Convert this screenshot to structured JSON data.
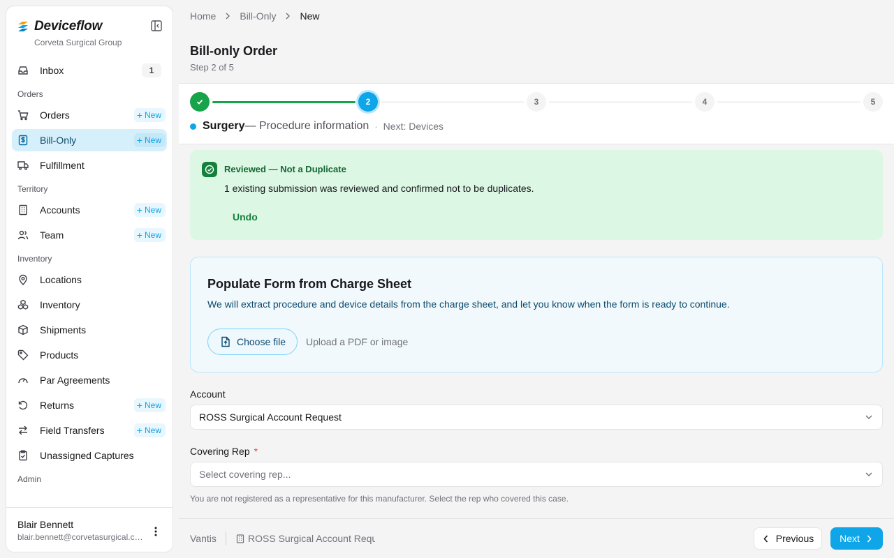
{
  "brand": {
    "name": "Deviceflow",
    "org": "Corveta Surgical Group"
  },
  "sidebar": {
    "inbox": {
      "label": "Inbox",
      "count": "1"
    },
    "sections": {
      "orders": "Orders",
      "territory": "Territory",
      "inventory": "Inventory",
      "admin": "Admin"
    },
    "new_label": "New",
    "items": {
      "orders": "Orders",
      "bill_only": "Bill-Only",
      "fulfillment": "Fulfillment",
      "accounts": "Accounts",
      "team": "Team",
      "locations": "Locations",
      "inventory": "Inventory",
      "shipments": "Shipments",
      "products": "Products",
      "par_agreements": "Par Agreements",
      "returns": "Returns",
      "field_transfers": "Field Transfers",
      "unassigned_captures": "Unassigned Captures"
    },
    "active_item": "bill_only"
  },
  "user": {
    "name": "Blair Bennett",
    "email": "blair.bennett@corvetasurgical.com"
  },
  "breadcrumb": {
    "home": "Home",
    "section": "Bill-Only",
    "current": "New"
  },
  "page": {
    "title": "Bill-only Order",
    "step": "Step 2 of 5"
  },
  "stepper": {
    "steps": [
      "1",
      "2",
      "3",
      "4",
      "5"
    ],
    "current_step": 2,
    "caption_title": "Surgery",
    "caption_sub": "— Procedure information",
    "caption_sep": "·",
    "caption_next": "Next: Devices"
  },
  "banner": {
    "title": "Reviewed — Not a Duplicate",
    "text": "1 existing submission was reviewed and confirmed not to be duplicates.",
    "undo": "Undo"
  },
  "upload": {
    "title": "Populate Form from Charge Sheet",
    "description": "We will extract procedure and device details from the charge sheet, and let you know when the form is ready to continue.",
    "button": "Choose file",
    "hint": "Upload a PDF or image"
  },
  "form": {
    "account_label": "Account",
    "account_value": "ROSS Surgical Account Request",
    "rep_label": "Covering Rep",
    "rep_required": "*",
    "rep_placeholder": "Select covering rep...",
    "rep_help": "You are not registered as a representative for this manufacturer. Select the rep who covered this case."
  },
  "footer": {
    "manufacturer": "Vantis",
    "account": "ROSS Surgical Account Request",
    "previous": "Previous",
    "next": "Next"
  },
  "colors": {
    "accent": "#0ea5e9",
    "success": "#16a34a",
    "active_nav_bg": "#d6f0fb",
    "banner_bg": "#dcf7e4"
  }
}
